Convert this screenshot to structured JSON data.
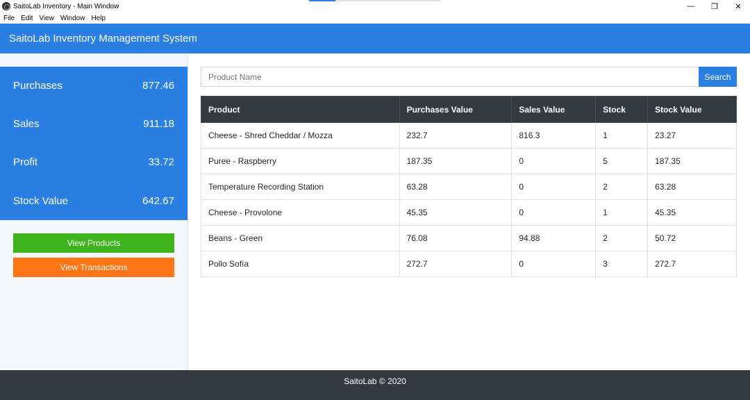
{
  "window": {
    "title": "SaitoLab Inventory - Main Window",
    "controls": {
      "minimize": "—",
      "restore": "❐",
      "close": "✕"
    }
  },
  "menu": {
    "items": [
      "File",
      "Edit",
      "View",
      "Window",
      "Help"
    ]
  },
  "header": {
    "title": "SaitoLab Inventory Management System"
  },
  "stats": [
    {
      "label": "Purchases",
      "value": "877.46"
    },
    {
      "label": "Sales",
      "value": "911.18"
    },
    {
      "label": "Profit",
      "value": "33.72"
    },
    {
      "label": "Stock Value",
      "value": "642.67"
    }
  ],
  "buttons": {
    "view_products": "View Products",
    "view_transactions": "View Transactions"
  },
  "search": {
    "placeholder": "Product Name",
    "value": "",
    "button": "Search"
  },
  "table": {
    "columns": [
      "Product",
      "Purchases Value",
      "Sales Value",
      "Stock",
      "Stock Value"
    ],
    "rows": [
      [
        "Cheese - Shred Cheddar / Mozza",
        "232.7",
        "816.3",
        "1",
        "23.27"
      ],
      [
        "Puree - Raspberry",
        "187.35",
        "0",
        "5",
        "187.35"
      ],
      [
        "Temperature Recording Station",
        "63.28",
        "0",
        "2",
        "63.28"
      ],
      [
        "Cheese - Provolone",
        "45.35",
        "0",
        "1",
        "45.35"
      ],
      [
        "Beans - Green",
        "76.08",
        "94.88",
        "2",
        "50.72"
      ],
      [
        "Pollo Sofía",
        "272.7",
        "0",
        "3",
        "272.7"
      ]
    ]
  },
  "footer": {
    "text": "SaitoLab © 2020"
  },
  "colors": {
    "accent": "#2a7fe3",
    "dark": "#343a40",
    "green": "#3fb51d",
    "orange": "#fd7514"
  }
}
